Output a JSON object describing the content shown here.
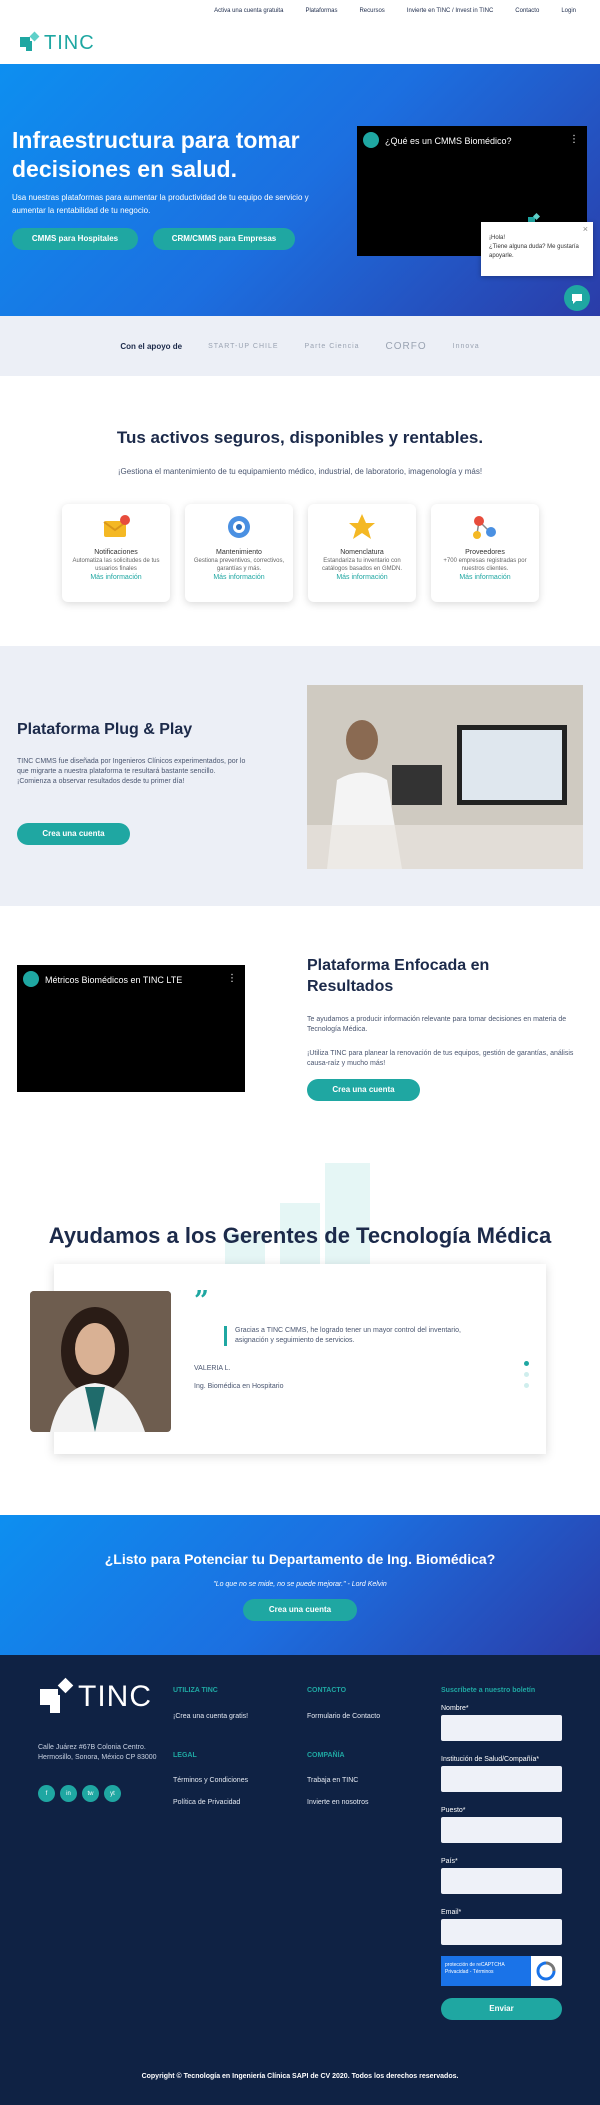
{
  "nav": {
    "items": [
      "Activa una cuenta gratuita",
      "Plataformas",
      "Recursos",
      "Invierte en TINC / Invest in TINC",
      "Contacto",
      "Login"
    ],
    "logo_text": "TINC"
  },
  "hero": {
    "title": "Infraestructura para tomar decisiones en salud.",
    "subtitle": "Usa nuestras plataformas para aumentar la productividad de tu equipo de servicio y aumentar la rentabilidad de tu negocio.",
    "btn_hospitals": "CMMS para Hospitales",
    "btn_companies": "CRM/CMMS para Empresas",
    "video_title": "¿Qué es un CMMS Biomédico?"
  },
  "chat": {
    "line1": "¡Hola!",
    "line2": "¿Tiene alguna duda? Me gustaría apoyarle."
  },
  "support": {
    "label": "Con el apoyo de",
    "sponsors": [
      "START-UP CHILE",
      "Parte Ciencia",
      "CORFO",
      "Innova"
    ]
  },
  "assets": {
    "title": "Tus activos seguros, disponibles y rentables.",
    "subtitle": "¡Gestiona el mantenimiento de tu equipamiento médico, industrial, de laboratorio, imagenología y más!",
    "more_label": "Más información",
    "cards": [
      {
        "icon": "envelope-icon",
        "title": "Notificaciones",
        "desc": "Automatiza las solicitudes de tus usuarios finales"
      },
      {
        "icon": "gear-icon",
        "title": "Mantenimiento",
        "desc": "Gestiona preventivos, correctivos, garantías y más."
      },
      {
        "icon": "star-icon",
        "title": "Nomenclatura",
        "desc": "Estandariza tu inventario con catálogos basados en GMDN."
      },
      {
        "icon": "network-icon",
        "title": "Proveedores",
        "desc": "+700 empresas registradas por nuestros clientes."
      }
    ]
  },
  "plug": {
    "title": "Plataforma Plug & Play",
    "text": "TINC CMMS fue diseñada por Ingenieros Clínicos experimentados, por lo que migrarte a nuestra plataforma te resultará bastante sencillo. ¡Comienza a observar resultados desde tu primer día!",
    "button": "Crea una cuenta"
  },
  "results": {
    "video_title": "Métricos Biomédicos en TINC LTE",
    "title": "Plataforma Enfocada en Resultados",
    "p1": "Te ayudamos a producir información relevante para tomar decisiones en materia de Tecnología Médica.",
    "p2": "¡Utiliza TINC para planear la renovación de tus equipos, gestión de garantías, análisis causa-raíz y mucho más!",
    "button": "Crea una cuenta"
  },
  "managers": {
    "title": "Ayudamos a los Gerentes de Tecnología Médica",
    "quote": "Gracias a TINC CMMS, he logrado tener un mayor control del inventario, asignación y seguimiento de servicios.",
    "name": "VALERIA L.",
    "role": "Ing. Biomédica en Hospitario"
  },
  "cta": {
    "title": "¿Listo para Potenciar tu Departamento de Ing. Biomédica?",
    "quote": "\"Lo que no se mide, no se puede mejorar.\" - Lord Kelvin",
    "button": "Crea una cuenta"
  },
  "footer": {
    "logo_text": "TINC",
    "address": "Calle Juárez #67B Colonia Centro. Hermosillo, Sonora, México CP 83000",
    "socials": [
      "f",
      "in",
      "tw",
      "yt"
    ],
    "col1_title": "UTILIZA TINC",
    "col1_link": "¡Crea una cuenta gratis!",
    "col2_title": "CONTACTO",
    "col2_link": "Formulario de Contacto",
    "col3_title": "LEGAL",
    "col3_links": [
      "Términos y Condiciones",
      "Política de Privacidad"
    ],
    "col4_title": "COMPAÑÍA",
    "col4_links": [
      "Trabaja en TINC",
      "Invierte en nosotros"
    ],
    "newsletter_title": "Suscríbete a nuestro boletín",
    "fields": [
      "Nombre*",
      "Institución de Salud/Compañía*",
      "Puesto*",
      "País*",
      "Email*"
    ],
    "recaptcha": "protección de reCAPTCHA",
    "recaptcha_sub": "Privacidad - Términos",
    "send": "Enviar",
    "copyright": "Copyright © Tecnología en Ingeniería Clínica SAPI de CV 2020. Todos los derechos reservados."
  }
}
